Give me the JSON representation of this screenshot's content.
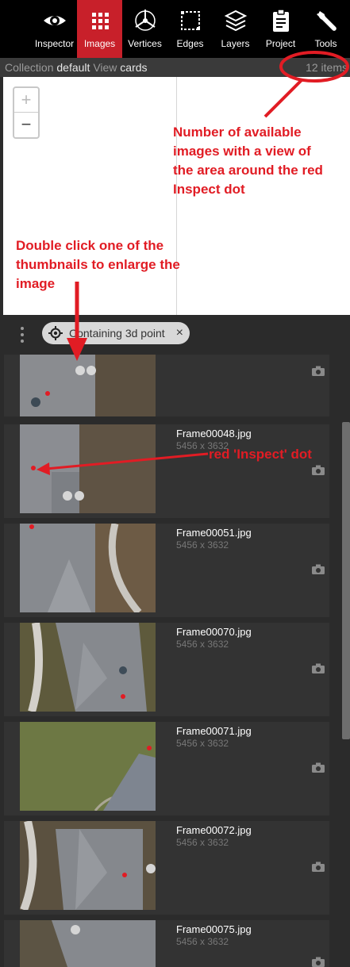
{
  "toolbar": {
    "tools": [
      {
        "label": "Inspector",
        "icon": "eye-icon"
      },
      {
        "label": "Images",
        "icon": "grid-icon",
        "active": true
      },
      {
        "label": "Vertices",
        "icon": "vertices-icon"
      },
      {
        "label": "Edges",
        "icon": "edges-icon"
      },
      {
        "label": "Layers",
        "icon": "layers-icon"
      },
      {
        "label": "Project",
        "icon": "clipboard-icon"
      },
      {
        "label": "Tools",
        "icon": "wrench-icon"
      }
    ],
    "accent": "#c8202a"
  },
  "collection": {
    "collection_label": "Collection",
    "collection_value": "default",
    "view_label": "View",
    "view_value": "cards",
    "count": "12 items"
  },
  "map": {
    "zoom_in": "+",
    "zoom_out": "−"
  },
  "filter": {
    "chip_text": "Containing 3d point",
    "chip_close": "×"
  },
  "images": [
    {
      "name": "",
      "dims": ""
    },
    {
      "name": "Frame00048.jpg",
      "dims": "5456 x 3632"
    },
    {
      "name": "Frame00051.jpg",
      "dims": "5456 x 3632"
    },
    {
      "name": "Frame00070.jpg",
      "dims": "5456 x 3632"
    },
    {
      "name": "Frame00071.jpg",
      "dims": "5456 x 3632"
    },
    {
      "name": "Frame00072.jpg",
      "dims": "5456 x 3632"
    },
    {
      "name": "Frame00075.jpg",
      "dims": "5456 x 3632"
    }
  ],
  "annotations": {
    "count_note": [
      "Number of available",
      "images with a view of",
      "the area around the red",
      "Inspect dot"
    ],
    "thumb_note": [
      "Double click one of the",
      "thumbnails to enlarge the",
      "image"
    ],
    "dot_note": "red 'Inspect' dot",
    "color": "#e11c24"
  }
}
